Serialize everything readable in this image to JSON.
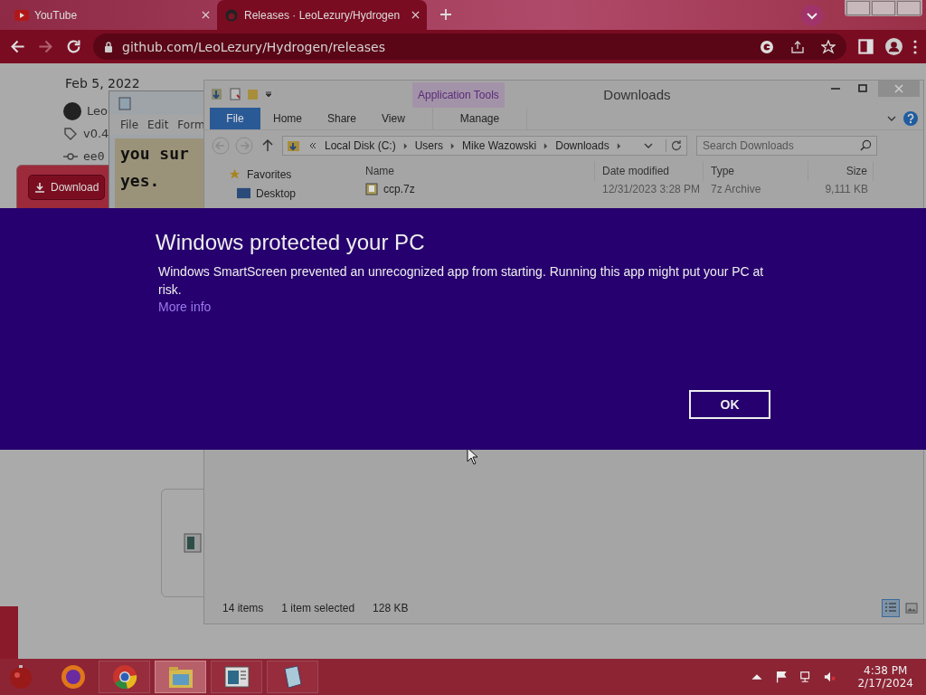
{
  "browser": {
    "tabs": [
      {
        "title": "YouTube",
        "kind": "youtube",
        "selected": false
      },
      {
        "title": "Releases · LeoLezury/Hydrogen",
        "kind": "github",
        "selected": true
      }
    ],
    "url": "github.com/LeoLezury/Hydrogen/releases"
  },
  "github_page": {
    "date": "Feb 5, 2022",
    "author": "Leo",
    "tag": "v0.4",
    "commit": "ee0",
    "download_button": "Download"
  },
  "notepad": {
    "menu": [
      "File",
      "Edit",
      "Form"
    ],
    "lines": [
      "you sur",
      "yes."
    ]
  },
  "explorer": {
    "title": "Downloads",
    "context_group": "Application Tools",
    "ribbon_tabs": [
      {
        "label": "File",
        "kind": "file_menu"
      },
      {
        "label": "Home",
        "kind": "tab"
      },
      {
        "label": "Share",
        "kind": "tab"
      },
      {
        "label": "View",
        "kind": "tab"
      },
      {
        "label": "Manage",
        "kind": "context"
      }
    ],
    "path": [
      "Local Disk (C:)",
      "Users",
      "Mike Wazowski",
      "Downloads"
    ],
    "search": {
      "placeholder": "Search Downloads"
    },
    "columns": [
      "Name",
      "Date modified",
      "Type",
      "Size"
    ],
    "nav": [
      {
        "label": "Favorites",
        "kind": "star"
      },
      {
        "label": "Desktop",
        "kind": "desktop"
      }
    ],
    "files": [
      {
        "name": "ccp.7z",
        "date": "12/31/2023 3:28 PM",
        "type": "7z Archive",
        "size": "9,111 KB"
      }
    ],
    "status": {
      "count": "14 items",
      "selection": "1 item selected",
      "size": "128 KB"
    }
  },
  "dialog": {
    "title": "Windows protected your PC",
    "message": "Windows SmartScreen prevented an unrecognized app from starting. Running this app might put your PC at risk.",
    "link": "More info",
    "button": "OK"
  },
  "taskbar": {
    "apps": [
      {
        "kind": "firefox",
        "selected": false
      },
      {
        "kind": "chrome",
        "selected": false
      },
      {
        "kind": "explorer",
        "selected": true
      },
      {
        "kind": "viewer",
        "selected": false
      },
      {
        "kind": "notepad",
        "selected": false
      }
    ],
    "time": "4:38 PM",
    "date": "2/17/2024"
  }
}
